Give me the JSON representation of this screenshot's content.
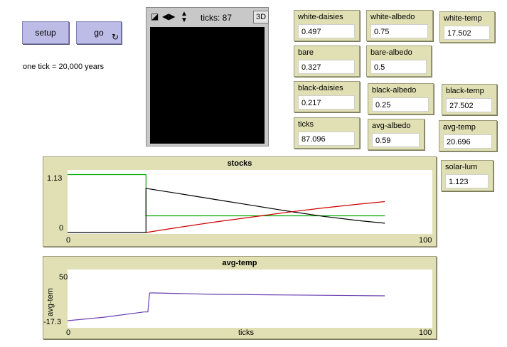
{
  "buttons": {
    "setup": "setup",
    "go": "go",
    "forever_icon": "forever-loop-icon"
  },
  "note": "one tick = 20,000 years",
  "view": {
    "ticks_label": "ticks: 87",
    "btn3d": "3D",
    "controls": [
      "view-edit-icon",
      "left-right-arrow-icon",
      "up-down-arrow-icon"
    ]
  },
  "monitors": {
    "white_daisies": {
      "label": "white-daisies",
      "value": "0.497"
    },
    "white_albedo": {
      "label": "white-albedo",
      "value": "0.75"
    },
    "white_temp": {
      "label": "white-temp",
      "value": "17.502"
    },
    "bare": {
      "label": "bare",
      "value": "0.327"
    },
    "bare_albedo": {
      "label": "bare-albedo",
      "value": "0.5"
    },
    "black_daisies": {
      "label": "black-daisies",
      "value": "0.217"
    },
    "black_albedo": {
      "label": "black-albedo",
      "value": "0.25"
    },
    "black_temp": {
      "label": "black-temp",
      "value": "27.502"
    },
    "ticks": {
      "label": "ticks",
      "value": "87.096"
    },
    "avg_albedo": {
      "label": "avg-albedo",
      "value": "0.59"
    },
    "avg_temp": {
      "label": "avg-temp",
      "value": "20.696"
    },
    "solar_lum": {
      "label": "solar-lum",
      "value": "1.123"
    }
  },
  "chart_data": [
    {
      "type": "line",
      "title": "stocks",
      "xlabel": "",
      "ylabel": "",
      "xlim": [
        0,
        100
      ],
      "ylim": [
        0,
        1.13
      ],
      "x_tick_labels": [
        "0",
        "100"
      ],
      "y_tick_labels": [
        "1.13",
        "0"
      ],
      "series": [
        {
          "color": "#00aa00",
          "points": [
            [
              0,
              1.18
            ],
            [
              21.5,
              1.18
            ],
            [
              21.5,
              0.34
            ],
            [
              87,
              0.34
            ]
          ]
        },
        {
          "color": "#000000",
          "points": [
            [
              0,
              0
            ],
            [
              21.5,
              0
            ],
            [
              21.5,
              0.9
            ],
            [
              30,
              0.8
            ],
            [
              40,
              0.68
            ],
            [
              50,
              0.56
            ],
            [
              60,
              0.44
            ],
            [
              70,
              0.33
            ],
            [
              80,
              0.24
            ],
            [
              87,
              0.19
            ]
          ]
        },
        {
          "color": "#cc0000",
          "points": [
            [
              21.5,
              0
            ],
            [
              30,
              0.1
            ],
            [
              40,
              0.21
            ],
            [
              50,
              0.31
            ],
            [
              60,
              0.41
            ],
            [
              70,
              0.5
            ],
            [
              80,
              0.58
            ],
            [
              87,
              0.63
            ]
          ]
        }
      ]
    },
    {
      "type": "line",
      "title": "avg-temp",
      "xlabel": "ticks",
      "ylabel": "avg-tem",
      "xlim": [
        0,
        100
      ],
      "ylim": [
        -17.3,
        50
      ],
      "x_tick_labels": [
        "0",
        "100"
      ],
      "y_tick_labels": [
        "50",
        "-17.3"
      ],
      "series": [
        {
          "color": "#6a3fb0",
          "points": [
            [
              0,
              -17.3
            ],
            [
              10,
              -12
            ],
            [
              21,
              -4
            ],
            [
              22,
              -4
            ],
            [
              22.5,
              25
            ],
            [
              24,
              25
            ],
            [
              40,
              23
            ],
            [
              60,
              22
            ],
            [
              80,
              21
            ],
            [
              87,
              20.7
            ]
          ]
        }
      ]
    }
  ]
}
